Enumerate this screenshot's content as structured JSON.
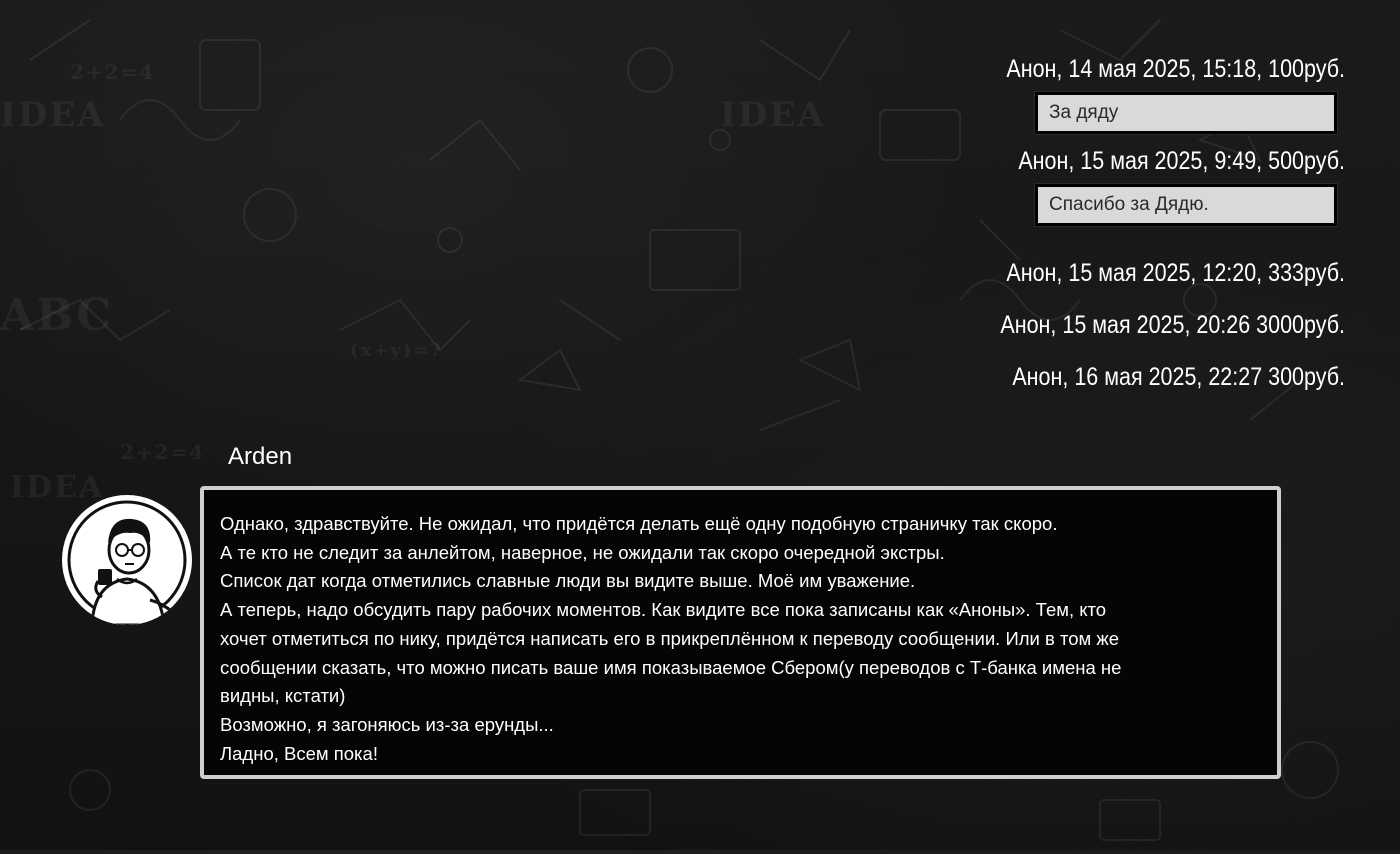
{
  "donations": [
    {
      "line": "Анон, 14 мая 2025, 15:18, 100руб.",
      "comment": "За дяду"
    },
    {
      "line": "Анон, 15 мая 2025, 9:49, 500руб.",
      "comment": "Спасибо за Дядю."
    },
    {
      "line": "Анон, 15 мая 2025, 12:20, 333руб.",
      "comment": ""
    },
    {
      "line": "Анон, 15 мая 2025, 20:26 3000руб.",
      "comment": ""
    },
    {
      "line": "Анон, 16 мая 2025, 22:27 300руб.",
      "comment": ""
    }
  ],
  "author": {
    "name": "Arden",
    "avatar_icon": "avatar-icon"
  },
  "message": {
    "lines": [
      "Однако, здравствуйте.  Не ожидал, что придётся делать ещё одну подобную страничку так скоро.",
      "А те кто не следит за анлейтом, наверное, не ожидали так скоро очередной экстры.",
      "Список дат когда отметились славные люди вы видите выше. Моё им уважение.",
      "А теперь, надо обсудить пару рабочих моментов. Как видите все пока записаны как «Аноны». Тем, кто",
      "хочет отметиться по нику, придётся написать его в прикреплённом к переводу сообщении. Или в том же",
      "сообщении сказать, что можно писать ваше имя показываемое Сбером(у переводов с Т-банка имена не",
      "видны, кстати)",
      "Возможно, я загоняюсь из-за ерунды...",
      "Ладно, Всем пока!"
    ]
  },
  "colors": {
    "background": "#171717",
    "text": "#ffffff",
    "comment_bg": "#d9d9d9",
    "message_border": "#cfcfcf",
    "message_bg": "#050505"
  }
}
